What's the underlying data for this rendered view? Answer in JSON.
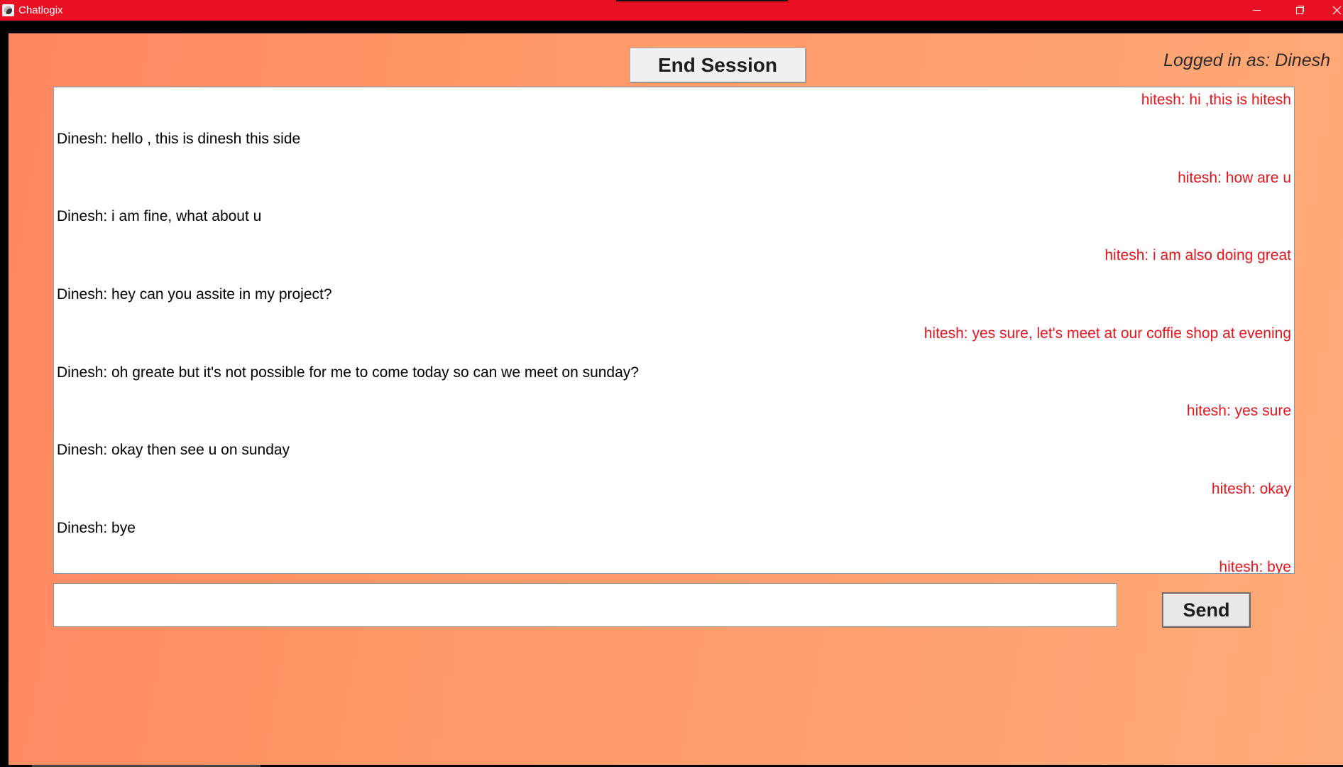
{
  "window": {
    "title": "Chatlogix",
    "minimize_label": "",
    "maximize_label": "",
    "close_label": ""
  },
  "header": {
    "end_session_label": "End Session",
    "logged_in_text": "Logged in as: Dinesh"
  },
  "chat": {
    "messages": [
      {
        "sender": "hitesh",
        "text": "hitesh: hi ,this is hitesh",
        "side": "right"
      },
      {
        "sender": "Dinesh",
        "text": "Dinesh: hello , this is dinesh this side",
        "side": "left"
      },
      {
        "sender": "hitesh",
        "text": "hitesh: how are u",
        "side": "right"
      },
      {
        "sender": "Dinesh",
        "text": "Dinesh: i am fine, what about u",
        "side": "left"
      },
      {
        "sender": "hitesh",
        "text": "hitesh: i am also doing great",
        "side": "right"
      },
      {
        "sender": "Dinesh",
        "text": "Dinesh: hey can you assite in my project?",
        "side": "left"
      },
      {
        "sender": "hitesh",
        "text": "hitesh: yes sure, let's meet at our coffie shop at evening",
        "side": "right"
      },
      {
        "sender": "Dinesh",
        "text": "Dinesh: oh greate but it's not possible for me to come today so can we meet on sunday?",
        "side": "left"
      },
      {
        "sender": "hitesh",
        "text": "hitesh: yes sure",
        "side": "right"
      },
      {
        "sender": "Dinesh",
        "text": "Dinesh: okay then see u on sunday",
        "side": "left"
      },
      {
        "sender": "hitesh",
        "text": "hitesh: okay",
        "side": "right"
      },
      {
        "sender": "Dinesh",
        "text": "Dinesh: bye",
        "side": "left"
      },
      {
        "sender": "hitesh",
        "text": "hitesh: bye",
        "side": "right"
      }
    ]
  },
  "composer": {
    "input_value": "",
    "send_label": "Send"
  },
  "colors": {
    "titlebar": "#e81123",
    "self_message": "#000000",
    "other_message": "#e8141c",
    "gradient_start": "#ff8760",
    "gradient_end": "#ffaa78"
  }
}
